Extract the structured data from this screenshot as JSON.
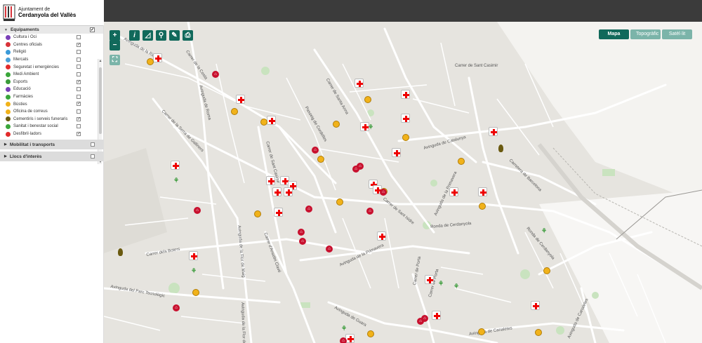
{
  "header": {
    "logo_line1": "Ajuntament de",
    "logo_line2": "Cerdanyola del Vallès"
  },
  "sidebar": {
    "section_title": "Equipaments",
    "items": [
      {
        "label": "Cultura i Oci",
        "color": "#7a3fb8",
        "checked": false
      },
      {
        "label": "Centres oficials",
        "color": "#d8333a",
        "checked": true
      },
      {
        "label": "Religió",
        "color": "#3a9ad9",
        "checked": false
      },
      {
        "label": "Mercats",
        "color": "#4aa0d8",
        "checked": false
      },
      {
        "label": "Seguretat i emergències",
        "color": "#e22b2b",
        "checked": false
      },
      {
        "label": "Medi Ambient",
        "color": "#3aa63a",
        "checked": false
      },
      {
        "label": "Esports",
        "color": "#3a9b3a",
        "checked": true
      },
      {
        "label": "Educació",
        "color": "#7a3fb8",
        "checked": false
      },
      {
        "label": "Farmàcies",
        "color": "#3aa63a",
        "checked": false
      },
      {
        "label": "Bústies",
        "color": "#f1b21a",
        "checked": true
      },
      {
        "label": "Oficina de correus",
        "color": "#f1b21a",
        "checked": false
      },
      {
        "label": "Cementiris i serveis funeraris",
        "color": "#6a5a10",
        "checked": true
      },
      {
        "label": "Sanitat i benestar social",
        "color": "#3aa63a",
        "checked": false
      },
      {
        "label": "Desfibril·ladors",
        "color": "#e22b2b",
        "checked": true
      }
    ],
    "sub_sections": [
      {
        "label": "Mobilitat i transports"
      },
      {
        "label": "Llocs d'interès"
      }
    ]
  },
  "toolbar": {
    "zoom_in": "+",
    "zoom_out": "−",
    "info": "i",
    "measure": "◿",
    "search": "⚲",
    "draw": "✎",
    "print": "⎙"
  },
  "base_layers": [
    {
      "label": "Mapa",
      "active": true
    },
    {
      "label": "Topogràfic",
      "active": false
    },
    {
      "label": "Satèl·lit",
      "active": false
    }
  ],
  "streets": [
    "Avinguda de la Riera",
    "Carrer de la Costa",
    "Avinguda de Roma",
    "Carrer de Santa Anna",
    "Passeig de Cordelles",
    "Carrer de la Serra de Galliners",
    "Carrer de Sant Casimir",
    "Avinguda de Catalunya",
    "Carretera de Barcelona",
    "Carrer de Sant Isidre",
    "Avinguda de la Primavera",
    "Ronda de Cerdanyola",
    "Carrer dels Boters",
    "Avinguda de la Flor de Maig",
    "Carrer d'Anselm Clavé",
    "Avinguda de la Primavera",
    "Avinguda del Parc Tecnològic",
    "Carrer de Porta",
    "Avinguda de Guara",
    "Avinguda de Canaletes",
    "Ronda de Cerdanyola",
    "Avinguda de Canaletes",
    "Avinguda de la Flor de Maig",
    "Carrer de Porta",
    "Carrer de Sant Casimir"
  ]
}
